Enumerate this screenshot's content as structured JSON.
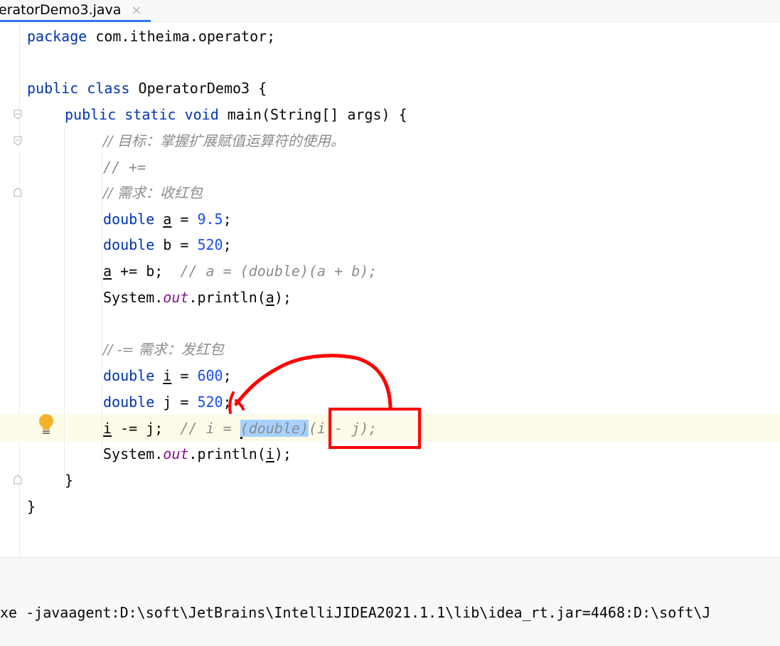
{
  "tab": {
    "filename": "eratorDemo3.java",
    "close_glyph": "×"
  },
  "code": {
    "l1": {
      "kw": "package",
      "rest": " com.itheima.operator;"
    },
    "l3": {
      "kw1": "public",
      "kw2": "class",
      "rest": " OperatorDemo3 {"
    },
    "l4": {
      "kw1": "public",
      "kw2": "static",
      "kw3": "void",
      "rest": " main(String[] args) {"
    },
    "l5": {
      "comment": "// 目标：掌握扩展赋值运算符的使用。"
    },
    "l6": {
      "comment": "// +="
    },
    "l7": {
      "comment": "// 需求：收红包"
    },
    "l8": {
      "kw": "double",
      "var": "a",
      "op": " = ",
      "num": "9.5",
      "end": ";"
    },
    "l9": {
      "kw": "double",
      "var": "b",
      "op": " = ",
      "num": "520",
      "end": ";"
    },
    "l10": {
      "var": "a",
      "stmt": " += b;",
      "comment": "// a = (double)(a + b);"
    },
    "l11": {
      "pre": "System.",
      "field": "out",
      "post": ".println(",
      "var": "a",
      "end": ");"
    },
    "l13": {
      "comment": "// -= 需求：发红包"
    },
    "l14": {
      "kw": "double",
      "var": "i",
      "op": " = ",
      "num": "600",
      "end": ";"
    },
    "l15": {
      "kw": "double",
      "var": "j",
      "op": " = ",
      "num": "520",
      "end": ";"
    },
    "l16": {
      "var": "i",
      "stmt": " -= j;",
      "comment_pre": "// i = ",
      "comment_sel": "(double)",
      "comment_post": "(i - j);"
    },
    "l17": {
      "pre": "System.",
      "field": "out",
      "post": ".println(",
      "var": "i",
      "end": ");"
    },
    "l18": {
      "text": "}"
    },
    "l19": {
      "text": "}"
    }
  },
  "console": {
    "command": "xe -javaagent:D:\\soft\\JetBrains\\IntelliJIDEA2021.1.1\\lib\\idea_rt.jar=4468:D:\\soft\\J"
  },
  "colors": {
    "keyword": "#0033b3",
    "number": "#1750eb",
    "comment": "#8c8c8c",
    "static_field": "#871094",
    "selection": "#a6d2ff",
    "annotation": "#ff0000"
  },
  "icons": [
    "lightbulb-icon",
    "fold-marker-icon",
    "close-icon"
  ]
}
